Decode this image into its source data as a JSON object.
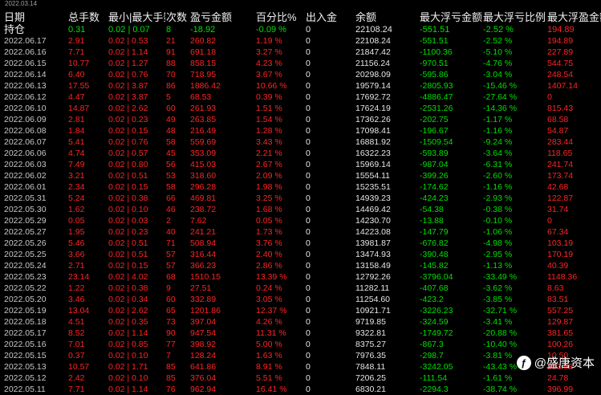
{
  "top_date": "2022.03.14",
  "headers": [
    "日期",
    "总手数",
    "最小|最大手数",
    "次数",
    "盈亏金额",
    "百分比%",
    "出入金",
    "余额",
    "最大浮亏金额",
    "最大浮亏比例",
    "最大浮盈金额"
  ],
  "hold_row": [
    "持仓",
    "0.31",
    "0.02 | 0.07",
    "8",
    "-18.92",
    "-0.09 %",
    "0",
    "22108.24",
    "-551.51",
    "-2.52 %",
    "194.89"
  ],
  "rows": [
    [
      "2022.06.17",
      "2.91",
      "0.02 | 0.53",
      "21",
      "260.82",
      "1.19 %",
      "0",
      "22108.24",
      "-551.51",
      "-2.52 %",
      "194.89"
    ],
    [
      "2022.06.16",
      "7.71",
      "0.02 | 1.14",
      "91",
      "691.18",
      "3.27 %",
      "0",
      "21847.42",
      "-1100.36",
      "-5.10 %",
      "227.89"
    ],
    [
      "2022.06.15",
      "10.77",
      "0.02 | 1.27",
      "88",
      "858.15",
      "4.23 %",
      "0",
      "21156.24",
      "-970.51",
      "-4.76 %",
      "544.75"
    ],
    [
      "2022.06.14",
      "6.40",
      "0.02 | 0.76",
      "70",
      "718.95",
      "3.67 %",
      "0",
      "20298.09",
      "-595.86",
      "-3.04 %",
      "248.54"
    ],
    [
      "2022.06.13",
      "17.55",
      "0.02 | 3.87",
      "86",
      "1886.42",
      "10.66 %",
      "0",
      "19579.14",
      "-2805.93",
      "-15.46 %",
      "1407.14"
    ],
    [
      "2022.06.12",
      "4.47",
      "0.02 | 3.87",
      "5",
      "68.53",
      "0.39 %",
      "0",
      "17692.72",
      "-4886.47",
      "-27.64 %",
      "0"
    ],
    [
      "2022.06.10",
      "14.87",
      "0.02 | 2.62",
      "60",
      "261.93",
      "1.51 %",
      "0",
      "17624.19",
      "-2531.26",
      "-14.36 %",
      "815.43"
    ],
    [
      "2022.06.09",
      "2.81",
      "0.02 | 0.23",
      "49",
      "263.85",
      "1.54 %",
      "0",
      "17362.26",
      "-202.75",
      "-1.17 %",
      "68.58"
    ],
    [
      "2022.06.08",
      "1.84",
      "0.02 | 0.15",
      "48",
      "216.49",
      "1.28 %",
      "0",
      "17098.41",
      "-196.67",
      "-1.16 %",
      "54.87"
    ],
    [
      "2022.06.07",
      "5.41",
      "0.02 | 0.76",
      "58",
      "559.69",
      "3.43 %",
      "0",
      "16881.92",
      "-1509.54",
      "-9.24 %",
      "283.44"
    ],
    [
      "2022.06.06",
      "4.74",
      "0.02 | 0.57",
      "45",
      "353.09",
      "2.21 %",
      "0",
      "16322.23",
      "-593.89",
      "-3.64 %",
      "118.65"
    ],
    [
      "2022.06.03",
      "7.49",
      "0.02 | 0.80",
      "56",
      "415.03",
      "2.67 %",
      "0",
      "15969.14",
      "-987.04",
      "-6.31 %",
      "241.74"
    ],
    [
      "2022.06.02",
      "3.21",
      "0.02 | 0.51",
      "53",
      "318.60",
      "2.09 %",
      "0",
      "15554.11",
      "-399.26",
      "-2.60 %",
      "173.74"
    ],
    [
      "2022.06.01",
      "2.34",
      "0.02 | 0.15",
      "58",
      "296.28",
      "1.98 %",
      "0",
      "15235.51",
      "-174.62",
      "-1.16 %",
      "42.68"
    ],
    [
      "2022.05.31",
      "5.24",
      "0.02 | 0.38",
      "66",
      "469.81",
      "3.25 %",
      "0",
      "14939.23",
      "-424.23",
      "-2.93 %",
      "122.87"
    ],
    [
      "2022.05.30",
      "1.62",
      "0.02 | 0.10",
      "46",
      "238.72",
      "1.68 %",
      "0",
      "14469.42",
      "-54.38",
      "-0.38 %",
      "31.74"
    ],
    [
      "2022.05.29",
      "0.05",
      "0.02 | 0.03",
      "2",
      "7.62",
      "0.05 %",
      "0",
      "14230.70",
      "-13.88",
      "-0.10 %",
      "0"
    ],
    [
      "2022.05.27",
      "1.95",
      "0.02 | 0.23",
      "40",
      "241.21",
      "1.73 %",
      "0",
      "14223.08",
      "-147.79",
      "-1.06 %",
      "67.34"
    ],
    [
      "2022.05.26",
      "5.46",
      "0.02 | 0.51",
      "71",
      "508.94",
      "3.76 %",
      "0",
      "13981.87",
      "-676.82",
      "-4.98 %",
      "103.19"
    ],
    [
      "2022.05.25",
      "3.66",
      "0.02 | 0.51",
      "57",
      "316.44",
      "2.40 %",
      "0",
      "13474.93",
      "-390.48",
      "-2.95 %",
      "170.19"
    ],
    [
      "2022.05.24",
      "2.71",
      "0.02 | 0.15",
      "57",
      "366.23",
      "2.86 %",
      "0",
      "13158.49",
      "-145.82",
      "-1.13 %",
      "40.39"
    ],
    [
      "2022.05.23",
      "23.14",
      "0.02 | 4.02",
      "68",
      "1510.15",
      "13.39 %",
      "0",
      "12792.26",
      "-3796.04",
      "-33.49 %",
      "1148.36"
    ],
    [
      "2022.05.22",
      "1.22",
      "0.02 | 0.38",
      "9",
      "27.51",
      "0.24 %",
      "0",
      "11282.11",
      "-407.68",
      "-3.62 %",
      "8.63"
    ],
    [
      "2022.05.20",
      "3.46",
      "0.02 | 0.34",
      "60",
      "332.89",
      "3.05 %",
      "0",
      "11254.60",
      "-423.2",
      "-3.85 %",
      "83.51"
    ],
    [
      "2022.05.19",
      "13.04",
      "0.02 | 2.62",
      "65",
      "1201.86",
      "12.37 %",
      "0",
      "10921.71",
      "-3226.23",
      "-32.71 %",
      "557.25"
    ],
    [
      "2022.05.18",
      "4.51",
      "0.02 | 0.35",
      "73",
      "397.04",
      "4.26 %",
      "0",
      "9719.85",
      "-324.59",
      "-3.41 %",
      "129.87"
    ],
    [
      "2022.05.17",
      "8.52",
      "0.02 | 1.14",
      "90",
      "947.54",
      "11.31 %",
      "0",
      "9322.81",
      "-1749.72",
      "-20.88 %",
      "381.65"
    ],
    [
      "2022.05.16",
      "7.01",
      "0.02 | 0.85",
      "77",
      "398.92",
      "5.00 %",
      "0",
      "8375.27",
      "-867.3",
      "-10.40 %",
      "100.26"
    ],
    [
      "2022.05.15",
      "0.37",
      "0.02 | 0.10",
      "7",
      "128.24",
      "1.63 %",
      "0",
      "7976.35",
      "-298.7",
      "-3.81 %",
      "10.50"
    ],
    [
      "2022.05.13",
      "10.57",
      "0.02 | 1.71",
      "85",
      "641.86",
      "8.91 %",
      "0",
      "7848.11",
      "-3242.05",
      "-43.43 %",
      "253.58"
    ],
    [
      "2022.05.12",
      "2.42",
      "0.02 | 0.10",
      "85",
      "376.04",
      "5.51 %",
      "0",
      "7206.25",
      "-111.54",
      "-1.61 %",
      "24.78"
    ],
    [
      "2022.05.11",
      "7.71",
      "0.02 | 1.14",
      "76",
      "962.94",
      "16.41 %",
      "0",
      "6830.21",
      "-2294.3",
      "-38.74 %",
      "396.99"
    ]
  ],
  "watermark": "@盛唐资本",
  "colors": {
    "positive": "#ff2424",
    "negative": "#00e000",
    "background": "#000000"
  }
}
